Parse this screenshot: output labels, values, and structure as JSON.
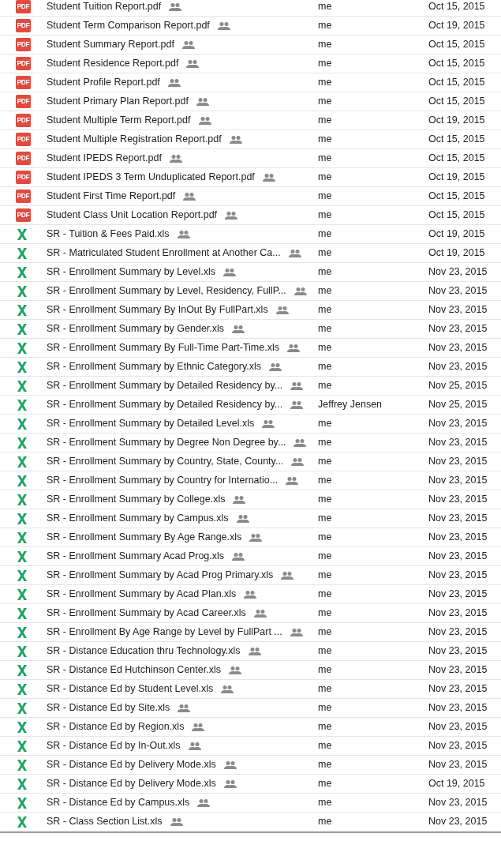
{
  "files": [
    {
      "kind": "pdf",
      "icon_label": "PDF",
      "name": "Student Tuition Report.pdf",
      "shared": true,
      "owner": "me",
      "modified": "Oct 15, 2015"
    },
    {
      "kind": "pdf",
      "icon_label": "PDF",
      "name": "Student Term Comparison Report.pdf",
      "shared": true,
      "owner": "me",
      "modified": "Oct 19, 2015"
    },
    {
      "kind": "pdf",
      "icon_label": "PDF",
      "name": "Student Summary Report.pdf",
      "shared": true,
      "owner": "me",
      "modified": "Oct 15, 2015"
    },
    {
      "kind": "pdf",
      "icon_label": "PDF",
      "name": "Student Residence Report.pdf",
      "shared": true,
      "owner": "me",
      "modified": "Oct 15, 2015"
    },
    {
      "kind": "pdf",
      "icon_label": "PDF",
      "name": "Student Profile Report.pdf",
      "shared": true,
      "owner": "me",
      "modified": "Oct 15, 2015"
    },
    {
      "kind": "pdf",
      "icon_label": "PDF",
      "name": "Student Primary Plan Report.pdf",
      "shared": true,
      "owner": "me",
      "modified": "Oct 15, 2015"
    },
    {
      "kind": "pdf",
      "icon_label": "PDF",
      "name": "Student Multiple Term Report.pdf",
      "shared": true,
      "owner": "me",
      "modified": "Oct 19, 2015"
    },
    {
      "kind": "pdf",
      "icon_label": "PDF",
      "name": "Student Multiple Registration Report.pdf",
      "shared": true,
      "owner": "me",
      "modified": "Oct 15, 2015"
    },
    {
      "kind": "pdf",
      "icon_label": "PDF",
      "name": "Student IPEDS Report.pdf",
      "shared": true,
      "owner": "me",
      "modified": "Oct 15, 2015"
    },
    {
      "kind": "pdf",
      "icon_label": "PDF",
      "name": "Student IPEDS 3 Term Unduplicated Report.pdf",
      "shared": true,
      "owner": "me",
      "modified": "Oct 19, 2015"
    },
    {
      "kind": "pdf",
      "icon_label": "PDF",
      "name": "Student First Time Report.pdf",
      "shared": true,
      "owner": "me",
      "modified": "Oct 15, 2015"
    },
    {
      "kind": "pdf",
      "icon_label": "PDF",
      "name": "Student Class Unit Location Report.pdf",
      "shared": true,
      "owner": "me",
      "modified": "Oct 15, 2015"
    },
    {
      "kind": "xls",
      "name": "SR - Tuition & Fees Paid.xls",
      "shared": true,
      "owner": "me",
      "modified": "Oct 19, 2015"
    },
    {
      "kind": "xls",
      "name": "SR - Matriculated Student Enrollment at Another Ca...",
      "shared": true,
      "owner": "me",
      "modified": "Oct 19, 2015"
    },
    {
      "kind": "xls",
      "name": "SR - Enrollment Summary by Level.xls",
      "shared": true,
      "owner": "me",
      "modified": "Nov 23, 2015"
    },
    {
      "kind": "xls",
      "name": "SR - Enrollment Summary by Level, Residency, FullP...",
      "shared": true,
      "owner": "me",
      "modified": "Nov 23, 2015"
    },
    {
      "kind": "xls",
      "name": "SR - Enrollment Summary By InOut By FullPart.xls",
      "shared": true,
      "owner": "me",
      "modified": "Nov 23, 2015"
    },
    {
      "kind": "xls",
      "name": "SR - Enrollment Summary by Gender.xls",
      "shared": true,
      "owner": "me",
      "modified": "Nov 23, 2015"
    },
    {
      "kind": "xls",
      "name": "SR - Enrollment Summary By Full-Time Part-Time.xls",
      "shared": true,
      "owner": "me",
      "modified": "Nov 23, 2015"
    },
    {
      "kind": "xls",
      "name": "SR - Enrollment Summary by Ethnic Category.xls",
      "shared": true,
      "owner": "me",
      "modified": "Nov 23, 2015"
    },
    {
      "kind": "xls",
      "name": "SR - Enrollment Summary by Detailed Residency by...",
      "shared": true,
      "owner": "me",
      "modified": "Nov 25, 2015"
    },
    {
      "kind": "xls",
      "name": "SR - Enrollment Summary by Detailed Residency by...",
      "shared": true,
      "owner": "Jeffrey Jensen",
      "modified": "Nov 25, 2015"
    },
    {
      "kind": "xls",
      "name": "SR - Enrollment Summary by Detailed Level.xls",
      "shared": true,
      "owner": "me",
      "modified": "Nov 23, 2015"
    },
    {
      "kind": "xls",
      "name": "SR - Enrollment Summary by Degree Non Degree by...",
      "shared": true,
      "owner": "me",
      "modified": "Nov 23, 2015"
    },
    {
      "kind": "xls",
      "name": "SR - Enrollment Summary by Country, State, County...",
      "shared": true,
      "owner": "me",
      "modified": "Nov 23, 2015"
    },
    {
      "kind": "xls",
      "name": "SR - Enrollment Summary by Country for Internatio...",
      "shared": true,
      "owner": "me",
      "modified": "Nov 23, 2015"
    },
    {
      "kind": "xls",
      "name": "SR - Enrollment Summary by College.xls",
      "shared": true,
      "owner": "me",
      "modified": "Nov 23, 2015"
    },
    {
      "kind": "xls",
      "name": "SR - Enrollment Summary by Campus.xls",
      "shared": true,
      "owner": "me",
      "modified": "Nov 23, 2015"
    },
    {
      "kind": "xls",
      "name": "SR - Enrollment Summary By Age Range.xls",
      "shared": true,
      "owner": "me",
      "modified": "Nov 23, 2015"
    },
    {
      "kind": "xls",
      "name": "SR - Enrollment Summary Acad Prog.xls",
      "shared": true,
      "owner": "me",
      "modified": "Nov 23, 2015"
    },
    {
      "kind": "xls",
      "name": "SR - Enrollment Summary by Acad Prog Primary.xls",
      "shared": true,
      "owner": "me",
      "modified": "Nov 23, 2015"
    },
    {
      "kind": "xls",
      "name": "SR - Enrollment Summary by Acad Plan.xls",
      "shared": true,
      "owner": "me",
      "modified": "Nov 23, 2015"
    },
    {
      "kind": "xls",
      "name": "SR - Enrollment Summary by Acad Career.xls",
      "shared": true,
      "owner": "me",
      "modified": "Nov 23, 2015"
    },
    {
      "kind": "xls",
      "name": "SR - Enrollment By Age Range by Level by FullPart ...",
      "shared": true,
      "owner": "me",
      "modified": "Nov 23, 2015"
    },
    {
      "kind": "xls",
      "name": "SR - Distance Education thru Technology.xls",
      "shared": true,
      "owner": "me",
      "modified": "Nov 23, 2015"
    },
    {
      "kind": "xls",
      "name": "SR - Distance Ed Hutchinson Center.xls",
      "shared": true,
      "owner": "me",
      "modified": "Nov 23, 2015"
    },
    {
      "kind": "xls",
      "name": "SR - Distance Ed by Student Level.xls",
      "shared": true,
      "owner": "me",
      "modified": "Nov 23, 2015"
    },
    {
      "kind": "xls",
      "name": "SR - Distance Ed by Site.xls",
      "shared": true,
      "owner": "me",
      "modified": "Nov 23, 2015"
    },
    {
      "kind": "xls",
      "name": "SR - Distance Ed by Region.xls",
      "shared": true,
      "owner": "me",
      "modified": "Nov 23, 2015"
    },
    {
      "kind": "xls",
      "name": "SR - Distance Ed by In-Out.xls",
      "shared": true,
      "owner": "me",
      "modified": "Nov 23, 2015"
    },
    {
      "kind": "xls",
      "name": "SR - Distance Ed by Delivery Mode.xls",
      "shared": true,
      "owner": "me",
      "modified": "Nov 23, 2015"
    },
    {
      "kind": "xls",
      "name": "SR - Distance Ed by Delivery Mode.xls",
      "shared": true,
      "owner": "me",
      "modified": "Oct 19, 2015"
    },
    {
      "kind": "xls",
      "name": "SR - Distance Ed by Campus.xls",
      "shared": true,
      "owner": "me",
      "modified": "Nov 23, 2015"
    },
    {
      "kind": "xls",
      "name": "SR - Class Section List.xls",
      "shared": true,
      "owner": "me",
      "modified": "Nov 23, 2015"
    }
  ]
}
